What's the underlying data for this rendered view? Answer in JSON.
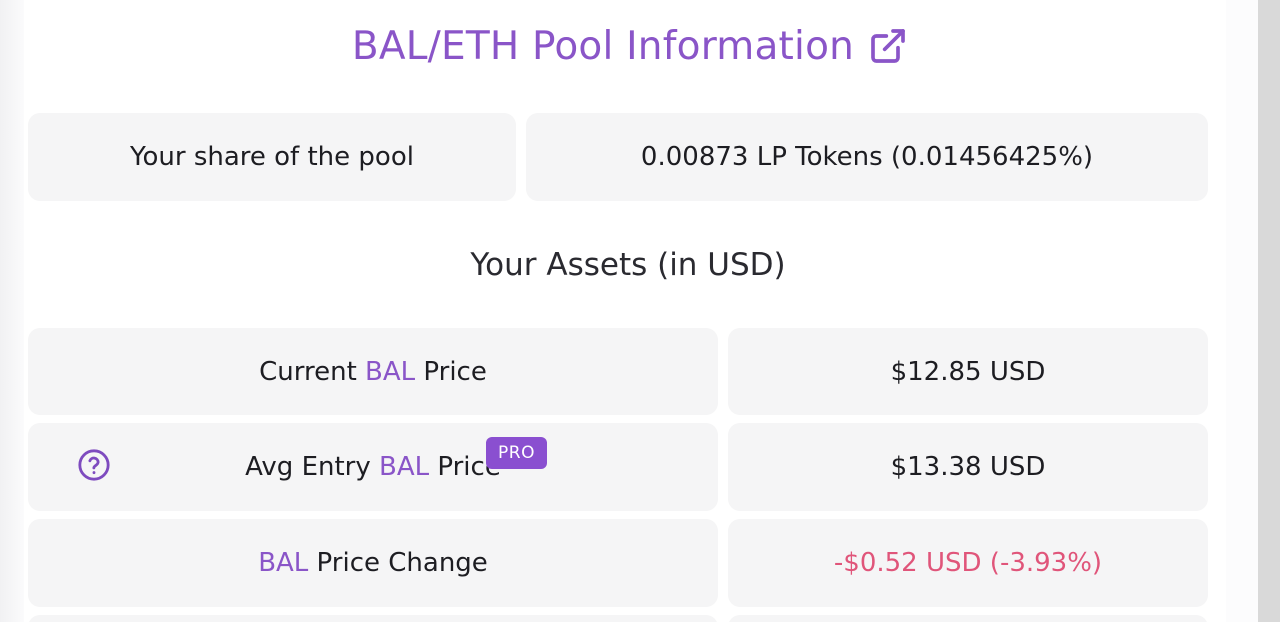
{
  "title": "BAL/ETH Pool Information",
  "share": {
    "label": "Your share of the pool",
    "value": "0.00873 LP Tokens (0.01456425%)"
  },
  "assets_heading": "Your Assets (in USD)",
  "rows": [
    {
      "label_prefix": "Current ",
      "token": "BAL",
      "label_suffix": " Price",
      "value": "$12.85 USD"
    },
    {
      "label_prefix": "Avg Entry ",
      "token": "BAL",
      "label_suffix": " Price",
      "badge": "PRO",
      "value": "$13.38 USD"
    },
    {
      "label_prefix": "",
      "token": "BAL",
      "label_suffix": " Price Change",
      "value": "-$0.52 USD (-3.93%)"
    }
  ],
  "colors": {
    "accent": "#8a55c8",
    "negative": "#e0557a",
    "cell_bg": "#f5f5f6",
    "badge_bg": "#8a4fd0"
  },
  "icons": {
    "title_link": "external-link-icon",
    "help": "question-circle-icon"
  }
}
